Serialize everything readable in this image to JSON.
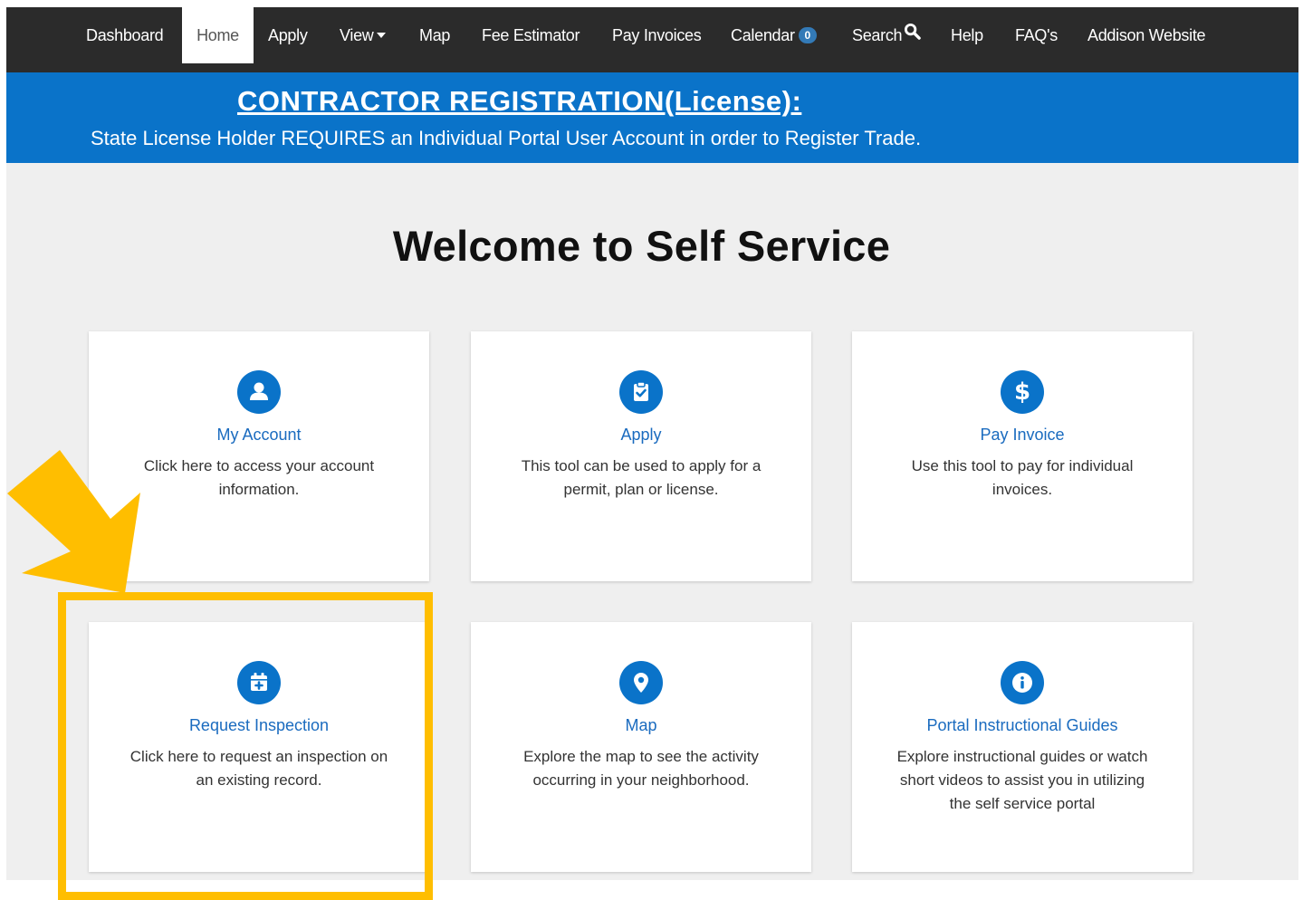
{
  "nav": {
    "items": [
      {
        "label": "Dashboard"
      },
      {
        "label": "Home"
      },
      {
        "label": "Apply"
      },
      {
        "label": "View"
      },
      {
        "label": "Map"
      },
      {
        "label": "Fee Estimator"
      },
      {
        "label": "Pay Invoices"
      },
      {
        "label": "Calendar",
        "badge": "0"
      },
      {
        "label": "Search"
      },
      {
        "label": "Help"
      },
      {
        "label": "FAQ's"
      },
      {
        "label": "Addison Website"
      }
    ],
    "active": "Home"
  },
  "banner": {
    "title": "CONTRACTOR REGISTRATION(License):",
    "subtitle": "State License Holder REQUIRES an Individual Portal User Account in order to Register Trade."
  },
  "page": {
    "heading": "Welcome to Self Service"
  },
  "cards": [
    {
      "icon": "user-icon",
      "title": "My Account",
      "description": "Click here to access your account information."
    },
    {
      "icon": "clipboard-check-icon",
      "title": "Apply",
      "description": "This tool can be used to apply for a permit, plan or license."
    },
    {
      "icon": "dollar-icon",
      "title": "Pay Invoice",
      "description": "Use this tool to pay for individual invoices."
    },
    {
      "icon": "calendar-plus-icon",
      "title": "Request Inspection",
      "description": "Click here to request an inspection on an existing record."
    },
    {
      "icon": "map-pin-icon",
      "title": "Map",
      "description": "Explore the map to see the activity occurring in your neighborhood."
    },
    {
      "icon": "info-icon",
      "title": "Portal Instructional Guides",
      "description": "Explore instructional guides or watch short videos to assist you in utilizing the self service portal"
    }
  ],
  "annotation": {
    "color": "#ffbe00",
    "target": "Request Inspection"
  },
  "colors": {
    "nav_bg": "#2b2b2b",
    "banner_bg": "#0a73c9",
    "accent": "#0a73c9",
    "link": "#1a6bbf",
    "page_bg": "#efefef"
  }
}
